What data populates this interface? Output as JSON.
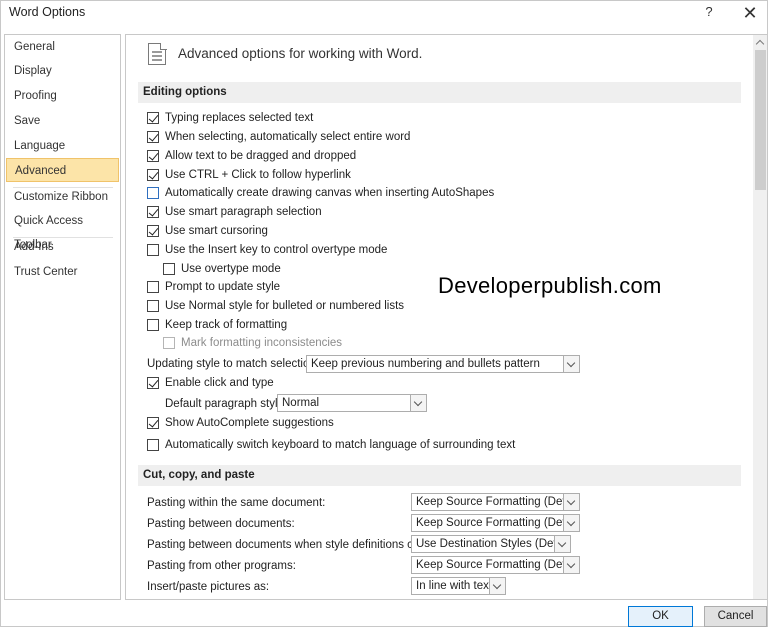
{
  "window": {
    "title": "Word Options",
    "help_label": "?",
    "close_label": "✕"
  },
  "nav": {
    "items": [
      {
        "label": "General"
      },
      {
        "label": "Display"
      },
      {
        "label": "Proofing"
      },
      {
        "label": "Save"
      },
      {
        "label": "Language"
      },
      {
        "label": "Advanced",
        "selected": true
      },
      {
        "label": "Customize Ribbon"
      },
      {
        "label": "Quick Access Toolbar"
      },
      {
        "label": "Add-Ins"
      },
      {
        "label": "Trust Center"
      }
    ]
  },
  "main": {
    "header": "Advanced options for working with Word.",
    "editing": {
      "title": "Editing options",
      "options": [
        {
          "label": "Typing replaces selected text",
          "checked": true
        },
        {
          "label": "When selecting, automatically select entire word",
          "checked": true
        },
        {
          "label": "Allow text to be dragged and dropped",
          "checked": true
        },
        {
          "label": "Use CTRL + Click to follow hyperlink",
          "checked": true
        },
        {
          "label": "Automatically create drawing canvas when inserting AutoShapes",
          "checked": false
        },
        {
          "label": "Use smart paragraph selection",
          "checked": true
        },
        {
          "label": "Use smart cursoring",
          "checked": true
        },
        {
          "label": "Use the Insert key to control overtype mode",
          "checked": false
        },
        {
          "label": "Use overtype mode",
          "checked": false
        },
        {
          "label": "Prompt to update style",
          "checked": false
        },
        {
          "label": "Use Normal style for bulleted or numbered lists",
          "checked": false
        },
        {
          "label": "Keep track of formatting",
          "checked": false
        },
        {
          "label": "Mark formatting inconsistencies",
          "checked": false
        }
      ],
      "updating_style_label": "Updating style to match selection:",
      "updating_style_value": "Keep previous numbering and bullets pattern",
      "enable_click_type": {
        "label": "Enable click and type",
        "checked": true
      },
      "default_paragraph_label": "Default paragraph style:",
      "default_paragraph_value": "Normal",
      "autocomplete": {
        "label": "Show AutoComplete suggestions",
        "checked": true
      },
      "switch_keyboard": {
        "label": "Automatically switch keyboard to match language of surrounding text",
        "checked": false
      }
    },
    "paste": {
      "title": "Cut, copy, and paste",
      "rows": [
        {
          "label": "Pasting within the same document:",
          "value": "Keep Source Formatting (Default)"
        },
        {
          "label": "Pasting between documents:",
          "value": "Keep Source Formatting (Default)"
        },
        {
          "label": "Pasting between documents when style definitions conflict:",
          "value": "Use Destination Styles (Default)"
        },
        {
          "label": "Pasting from other programs:",
          "value": "Keep Source Formatting (Default)"
        },
        {
          "label": "Insert/paste pictures as:",
          "value": "In line with text"
        }
      ]
    },
    "watermark": "Developerpublish.com"
  },
  "buttons": {
    "ok": "OK",
    "cancel": "Cancel"
  }
}
